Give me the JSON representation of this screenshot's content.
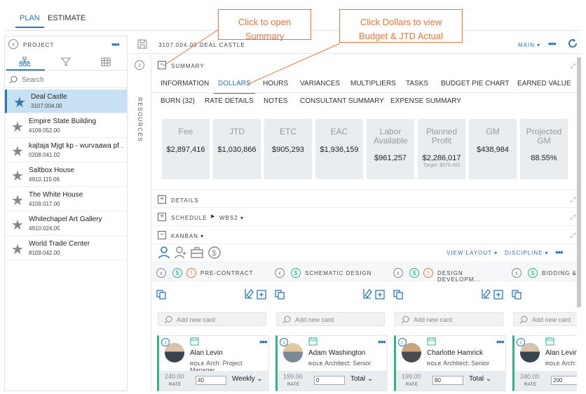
{
  "top_tabs": [
    "PLAN",
    "ESTIMATE"
  ],
  "left": {
    "header": "PROJECT",
    "search_placeholder": "Search",
    "projects": [
      {
        "name": "Deal Castle",
        "code": "3107.004.00",
        "selected": true
      },
      {
        "name": "Empire State Building",
        "code": "4109.052.00"
      },
      {
        "name": "kajtaja Mjgt kp - wurvaawa pf ...",
        "code": "0208.041.02"
      },
      {
        "name": "Saltbox House",
        "code": "4910.115.06"
      },
      {
        "name": "The White House",
        "code": "4109.017.00"
      },
      {
        "name": "Whitechapel Art Gallery",
        "code": "4910.024.05"
      },
      {
        "name": "World Trade Center",
        "code": "8109.042.00"
      }
    ]
  },
  "resources_label": "RESOURCES",
  "header": {
    "title": "3107.004.00 DEAL CASTLE",
    "view": "MAIN ▾"
  },
  "summary_label": "SUMMARY",
  "tabs_row1": [
    "INFORMATION",
    "DOLLARS",
    "HOURS",
    "VARIANCES",
    "MULTIPLIERS",
    "TASKS",
    "BUDGET PIE CHART",
    "EARNED VALUE"
  ],
  "tabs_row2": [
    "BURN (32)",
    "RATE DETAILS",
    "NOTES",
    "CONSULTANT SUMMARY",
    "EXPENSE SUMMARY"
  ],
  "kpis": [
    {
      "title": "Fee",
      "value": "$2,897,416"
    },
    {
      "title": "JTD",
      "value": "$1,030,866"
    },
    {
      "title": "ETC",
      "value": "$905,293"
    },
    {
      "title": "EAC",
      "value": "$1,936,159"
    },
    {
      "title": "Labor Available",
      "value": "$961,257"
    },
    {
      "title": "Planned Profit",
      "value": "$2,286,017",
      "target": "Target:   $579,483"
    },
    {
      "title": "GM",
      "value": "$438,984"
    },
    {
      "title": "Projected GM",
      "value": "88.55%"
    }
  ],
  "sections": {
    "details": "DETAILS",
    "schedule": "SCHEDULE",
    "wbs": "WBS2 ▾",
    "kanban": "KANBAN ▾"
  },
  "kanban_toolbar": {
    "view_layout": "VIEW LAYOUT ▾",
    "discipline": "DISCIPLINE ▾"
  },
  "add_card_placeholder": "Add new card",
  "columns": [
    {
      "title": "PRE-CONTRACT",
      "warn": true,
      "card": {
        "name": "Alan Levin",
        "role": "Arch: Project Manager",
        "rate": "240.00",
        "input": "40",
        "period": "Weekly ⌄"
      }
    },
    {
      "title": "SCHEMATIC DESIGN",
      "warn": false,
      "card": {
        "name": "Adam Washington",
        "role": "Architect: Senior",
        "rate": "199.00",
        "input": "0",
        "period": "Total ⌄"
      }
    },
    {
      "title": "DESIGN DEVELOPM...",
      "warn": true,
      "card": {
        "name": "Charlotte Hamrick",
        "role": "Architect: Senior",
        "rate": "199.00",
        "input": "80",
        "period": "Total ⌄"
      }
    },
    {
      "title": "BIDDING &",
      "warn": false,
      "card": {
        "name": "Alan Levin",
        "role": "Arch: Pr",
        "rate": "240.00",
        "input": "200",
        "period": ""
      }
    }
  ],
  "role_label": "ROLE",
  "rate_label": "RATE",
  "callouts": {
    "c1": "Click to open Summary",
    "c2": "Click Dollars to view Budget & JTD Actual"
  },
  "colors": {
    "accent": "#2a7ab8",
    "callout": "#e8763a",
    "green": "#2cb58c"
  }
}
